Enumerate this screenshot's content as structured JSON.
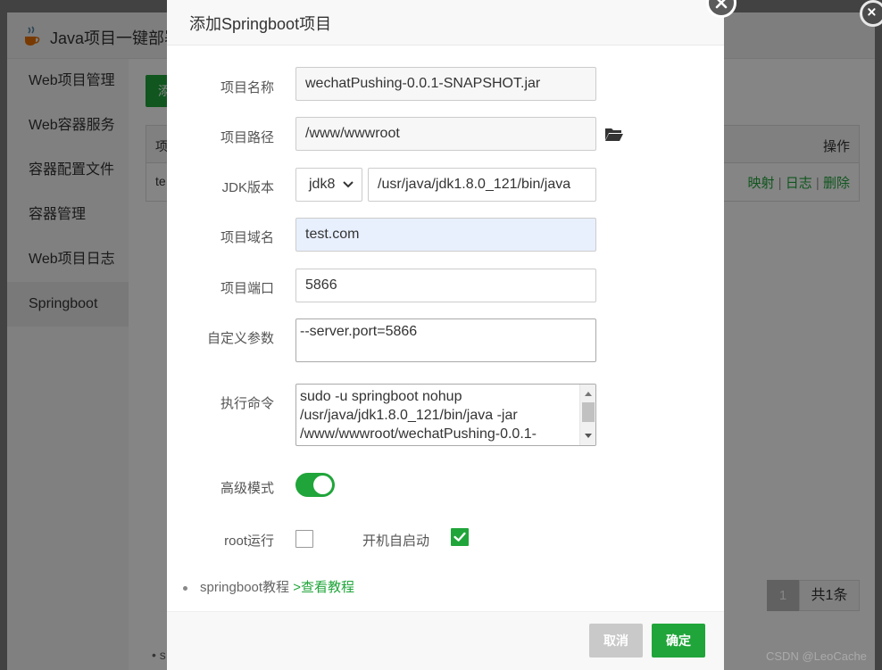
{
  "background": {
    "title": "Java项目一键部署",
    "sidebar": [
      "Web项目管理",
      "Web容器服务",
      "容器配置文件",
      "容器管理",
      "Web项目日志",
      "Springboot"
    ],
    "active_index": 5,
    "add_button_partial": "添",
    "table_header_first": "项",
    "table_header_ops": "操作",
    "row_first": "te",
    "row_ops": [
      "映射",
      "日志",
      "删除"
    ],
    "row_separator": "|",
    "pager_page": "1",
    "pager_total": "共1条",
    "bottom_fragment": "s"
  },
  "modal": {
    "title": "添加Springboot项目",
    "fields": {
      "name": {
        "label": "项目名称",
        "value": "wechatPushing-0.0.1-SNAPSHOT.jar"
      },
      "path": {
        "label": "项目路径",
        "value": "/www/wwwroot"
      },
      "jdk": {
        "label": "JDK版本",
        "selected": "jdk8",
        "path": "/usr/java/jdk1.8.0_121/bin/java"
      },
      "domain": {
        "label": "项目域名",
        "value": "test.com"
      },
      "port": {
        "label": "项目端口",
        "value": "5866"
      },
      "params": {
        "label": "自定义参数",
        "value": "--server.port=5866"
      },
      "command": {
        "label": "执行命令",
        "value": "sudo -u springboot nohup\n/usr/java/jdk1.8.0_121/bin/java -jar\n/www/wwwroot/wechatPushing-0.0.1-"
      },
      "advanced": {
        "label": "高级模式",
        "on": true
      },
      "root_run": {
        "label": "root运行",
        "checked": false
      },
      "autostart": {
        "label": "开机自启动",
        "checked": true
      }
    },
    "tutorial": {
      "text": "springboot教程",
      "link": ">查看教程"
    },
    "buttons": {
      "cancel": "取消",
      "ok": "确定"
    }
  },
  "watermark": "CSDN @LeoCache",
  "colors": {
    "accent": "#20a53a",
    "cancel": "#c9c9c9",
    "overlay": "rgba(0,0,0,0.48)"
  }
}
